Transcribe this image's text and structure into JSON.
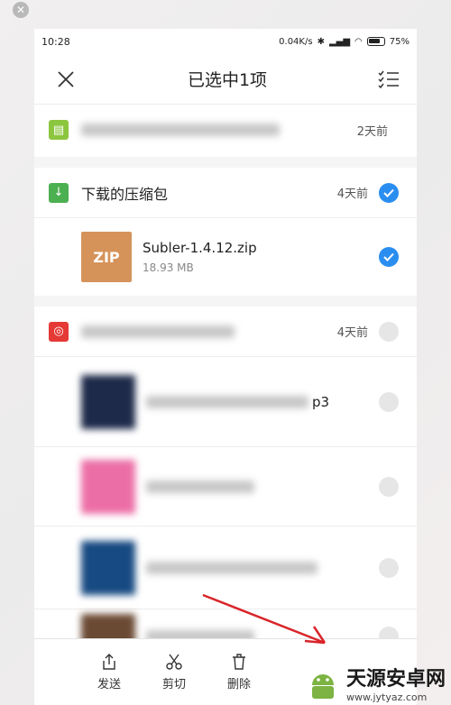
{
  "status": {
    "time": "10:28",
    "speed": "0.04K/s",
    "battery": "75%"
  },
  "header": {
    "title": "已选中1项",
    "close_icon": "close-icon",
    "select_icon": "checklist-icon"
  },
  "groups": [
    {
      "title": "",
      "time": "2天前",
      "icon_color": "#8cc63f",
      "checked": false,
      "blurred": true
    },
    {
      "title": "下载的压缩包",
      "time": "4天前",
      "icon_color": "#4caf50",
      "checked": true,
      "files": [
        {
          "name": "Subler-1.4.12.zip",
          "size": "18.93 MB",
          "thumb": "ZIP",
          "checked": true
        }
      ]
    },
    {
      "title": "",
      "time": "4天前",
      "icon_color": "#e53935",
      "checked": false,
      "blurred": true,
      "files": [
        {
          "name": "",
          "partial_suffix": "p3",
          "checked": false
        },
        {
          "name": "",
          "checked": false
        },
        {
          "name": "",
          "checked": false
        },
        {
          "name": "",
          "checked": false
        }
      ]
    }
  ],
  "toolbar": {
    "send": "发送",
    "cut": "剪切",
    "delete": "删除"
  },
  "watermark": {
    "name": "天源安卓网",
    "url": "www.jytyaz.com"
  },
  "colors": {
    "accent": "#2a8ef0",
    "zip_thumb": "#d5935a"
  }
}
